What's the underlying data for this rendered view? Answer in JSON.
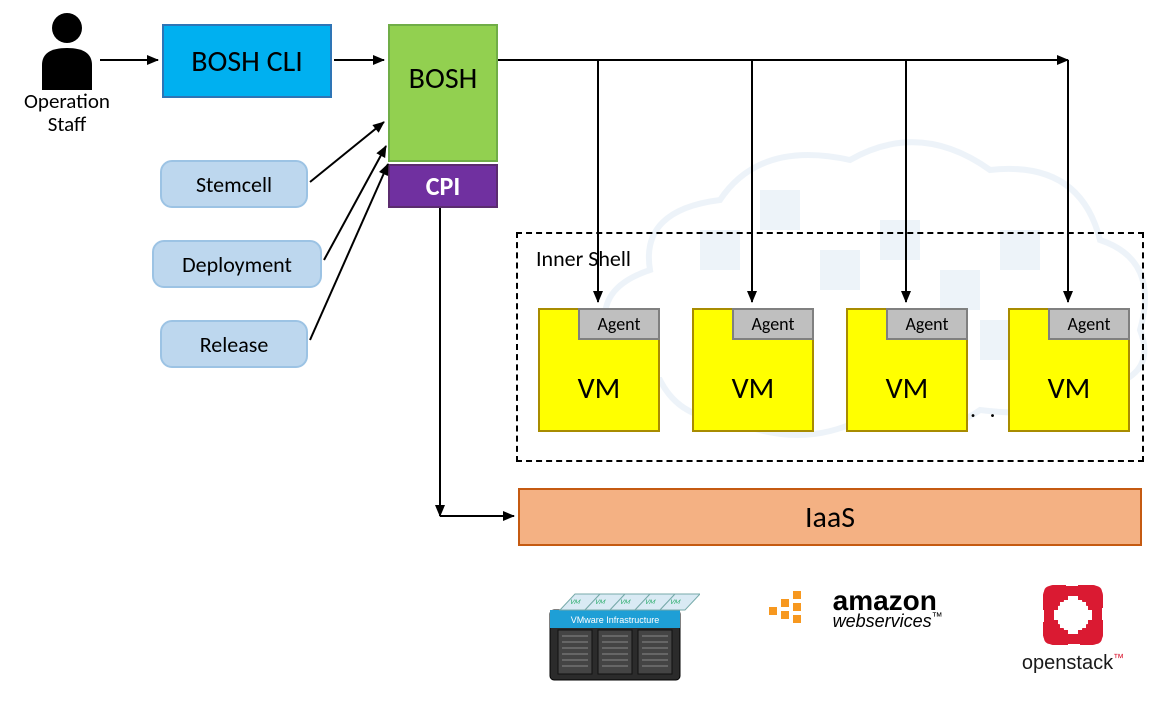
{
  "actor": {
    "label_line1": "Operation",
    "label_line2": "Staff"
  },
  "cli": {
    "label": "BOSH CLI"
  },
  "bosh": {
    "label": "BOSH"
  },
  "cpi": {
    "label": "CPI"
  },
  "inputs": [
    {
      "label": "Stemcell"
    },
    {
      "label": "Deployment"
    },
    {
      "label": "Release"
    }
  ],
  "inner_shell": {
    "label": "Inner Shell"
  },
  "vms": [
    {
      "agent": "Agent",
      "label": "VM"
    },
    {
      "agent": "Agent",
      "label": "VM"
    },
    {
      "agent": "Agent",
      "label": "VM"
    },
    {
      "agent": "Agent",
      "label": "VM"
    }
  ],
  "ellipsis": ". . .",
  "iaas": {
    "label": "IaaS"
  },
  "providers": {
    "vmware": {
      "label": "VMware Infrastructure"
    },
    "aws": {
      "name": "amazon",
      "sub": "webservices",
      "tm": "™"
    },
    "openstack": {
      "name": "openstack",
      "tm": "™"
    }
  }
}
